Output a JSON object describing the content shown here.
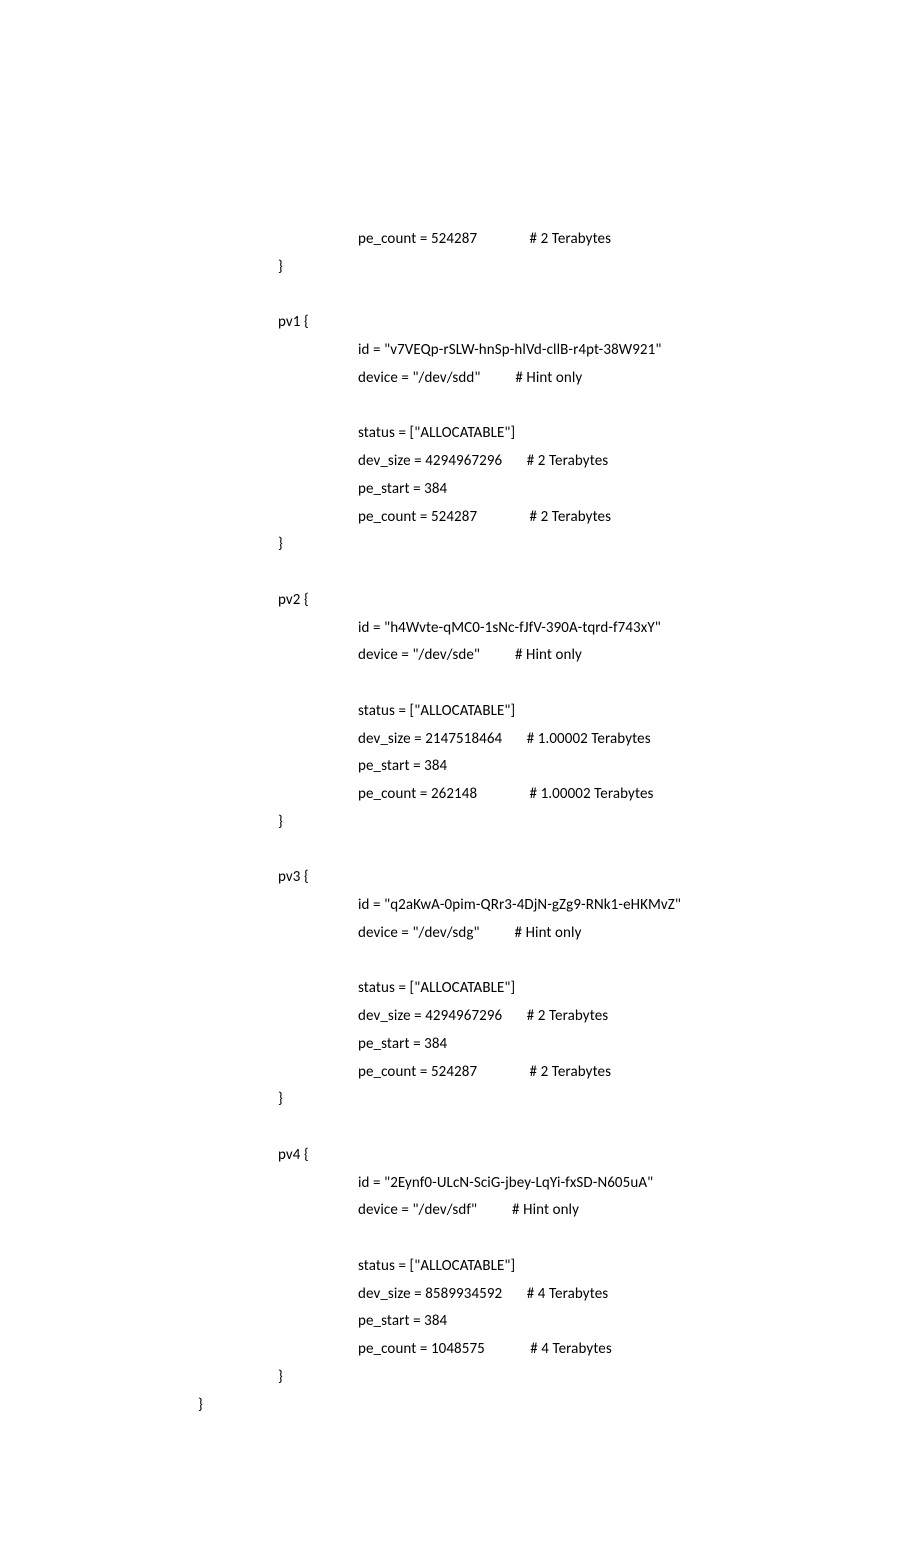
{
  "lines": [
    {
      "indent": 2,
      "text": "pe_count = 524287               # 2 Terabytes"
    },
    {
      "indent": 1,
      "text": "}"
    },
    {
      "indent": 1,
      "text": ""
    },
    {
      "indent": 1,
      "text": "pv1 {"
    },
    {
      "indent": 2,
      "text": "id = \"v7VEQp-rSLW-hnSp-hlVd-cllB-r4pt-38W921\""
    },
    {
      "indent": 2,
      "text": "device = \"/dev/sdd\"          # Hint only"
    },
    {
      "indent": 2,
      "text": ""
    },
    {
      "indent": 2,
      "text": "status = [\"ALLOCATABLE\"]"
    },
    {
      "indent": 2,
      "text": "dev_size = 4294967296       # 2 Terabytes"
    },
    {
      "indent": 2,
      "text": "pe_start = 384"
    },
    {
      "indent": 2,
      "text": "pe_count = 524287               # 2 Terabytes"
    },
    {
      "indent": 1,
      "text": "}"
    },
    {
      "indent": 1,
      "text": ""
    },
    {
      "indent": 1,
      "text": "pv2 {"
    },
    {
      "indent": 2,
      "text": "id = \"h4Wvte-qMC0-1sNc-fJfV-390A-tqrd-f743xY\""
    },
    {
      "indent": 2,
      "text": "device = \"/dev/sde\"          # Hint only"
    },
    {
      "indent": 2,
      "text": ""
    },
    {
      "indent": 2,
      "text": "status = [\"ALLOCATABLE\"]"
    },
    {
      "indent": 2,
      "text": "dev_size = 2147518464       # 1.00002 Terabytes"
    },
    {
      "indent": 2,
      "text": "pe_start = 384"
    },
    {
      "indent": 2,
      "text": "pe_count = 262148               # 1.00002 Terabytes"
    },
    {
      "indent": 1,
      "text": "}"
    },
    {
      "indent": 1,
      "text": ""
    },
    {
      "indent": 1,
      "text": "pv3 {"
    },
    {
      "indent": 2,
      "text": "id = \"q2aKwA-0pim-QRr3-4DjN-gZg9-RNk1-eHKMvZ\""
    },
    {
      "indent": 2,
      "text": "device = \"/dev/sdg\"          # Hint only"
    },
    {
      "indent": 2,
      "text": ""
    },
    {
      "indent": 2,
      "text": "status = [\"ALLOCATABLE\"]"
    },
    {
      "indent": 2,
      "text": "dev_size = 4294967296       # 2 Terabytes"
    },
    {
      "indent": 2,
      "text": "pe_start = 384"
    },
    {
      "indent": 2,
      "text": "pe_count = 524287               # 2 Terabytes"
    },
    {
      "indent": 1,
      "text": "}"
    },
    {
      "indent": 1,
      "text": ""
    },
    {
      "indent": 1,
      "text": "pv4 {"
    },
    {
      "indent": 2,
      "text": "id = \"2Eynf0-ULcN-SciG-jbey-LqYi-fxSD-N605uA\""
    },
    {
      "indent": 2,
      "text": "device = \"/dev/sdf\"          # Hint only"
    },
    {
      "indent": 2,
      "text": ""
    },
    {
      "indent": 2,
      "text": "status = [\"ALLOCATABLE\"]"
    },
    {
      "indent": 2,
      "text": "dev_size = 8589934592       # 4 Terabytes"
    },
    {
      "indent": 2,
      "text": "pe_start = 384"
    },
    {
      "indent": 2,
      "text": "pe_count = 1048575             # 4 Terabytes"
    },
    {
      "indent": 1,
      "text": "}"
    },
    {
      "indent": 0,
      "text": "}"
    }
  ]
}
